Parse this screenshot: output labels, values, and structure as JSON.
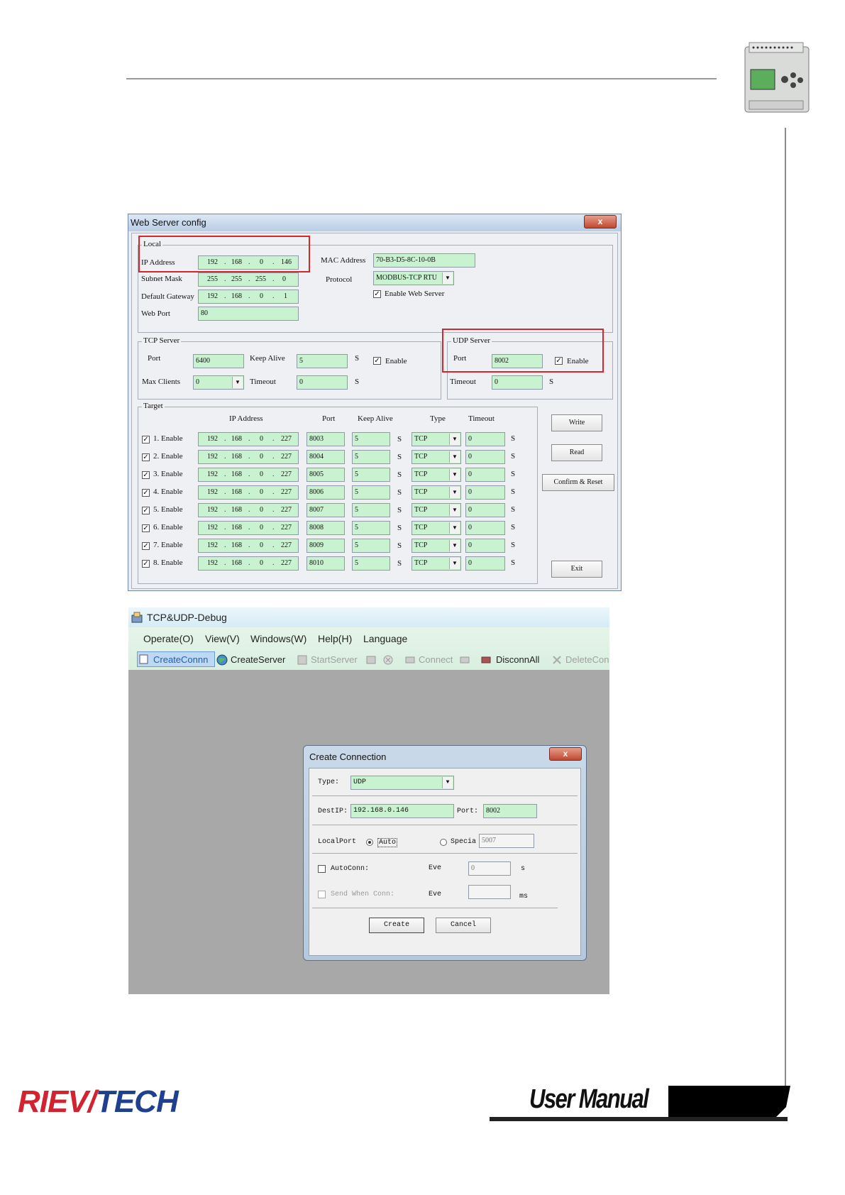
{
  "web_server_config": {
    "title": "Web Server config",
    "close": "x",
    "local": {
      "title": "Local",
      "ip_label": "IP Address",
      "ip": [
        "192",
        "168",
        "0",
        "146"
      ],
      "subnet_label": "Subnet Mask",
      "subnet": [
        "255",
        "255",
        "255",
        "0"
      ],
      "gateway_label": "Default Gateway",
      "gateway": [
        "192",
        "168",
        "0",
        "1"
      ],
      "webport_label": "Web Port",
      "webport": "80",
      "mac_label": "MAC Address",
      "mac": "70-B3-D5-8C-10-0B",
      "protocol_label": "Protocol",
      "protocol": "MODBUS-TCP RTU",
      "enable_web_label": "Enable Web Server"
    },
    "tcp_server": {
      "title": "TCP Server",
      "port_label": "Port",
      "port": "6400",
      "keepalive_label": "Keep Alive",
      "keepalive": "5",
      "unit": "S",
      "enable_label": "Enable",
      "maxclients_label": "Max Clients",
      "maxclients": "0",
      "timeout_label": "Timeout",
      "timeout": "0"
    },
    "udp_server": {
      "title": "UDP Server",
      "port_label": "Port",
      "port": "8002",
      "enable_label": "Enable",
      "timeout_label": "Timeout",
      "timeout": "0",
      "unit": "S"
    },
    "target": {
      "title": "Target",
      "headers": [
        "IP Address",
        "Port",
        "Keep Alive",
        "Type",
        "Timeout"
      ],
      "rows": [
        {
          "label": "1. Enable",
          "ip": [
            "192",
            "168",
            "0",
            "227"
          ],
          "port": "8003",
          "keepalive": "5",
          "type": "TCP",
          "timeout": "0"
        },
        {
          "label": "2. Enable",
          "ip": [
            "192",
            "168",
            "0",
            "227"
          ],
          "port": "8004",
          "keepalive": "5",
          "type": "TCP",
          "timeout": "0"
        },
        {
          "label": "3. Enable",
          "ip": [
            "192",
            "168",
            "0",
            "227"
          ],
          "port": "8005",
          "keepalive": "5",
          "type": "TCP",
          "timeout": "0"
        },
        {
          "label": "4. Enable",
          "ip": [
            "192",
            "168",
            "0",
            "227"
          ],
          "port": "8006",
          "keepalive": "5",
          "type": "TCP",
          "timeout": "0"
        },
        {
          "label": "5. Enable",
          "ip": [
            "192",
            "168",
            "0",
            "227"
          ],
          "port": "8007",
          "keepalive": "5",
          "type": "TCP",
          "timeout": "0"
        },
        {
          "label": "6. Enable",
          "ip": [
            "192",
            "168",
            "0",
            "227"
          ],
          "port": "8008",
          "keepalive": "5",
          "type": "TCP",
          "timeout": "0"
        },
        {
          "label": "7. Enable",
          "ip": [
            "192",
            "168",
            "0",
            "227"
          ],
          "port": "8009",
          "keepalive": "5",
          "type": "TCP",
          "timeout": "0"
        },
        {
          "label": "8. Enable",
          "ip": [
            "192",
            "168",
            "0",
            "227"
          ],
          "port": "8010",
          "keepalive": "5",
          "type": "TCP",
          "timeout": "0"
        }
      ],
      "unit": "S"
    },
    "buttons": {
      "write": "Write",
      "read": "Read",
      "confirm": "Confirm & Reset",
      "exit": "Exit"
    }
  },
  "debug": {
    "title": "TCP&UDP-Debug",
    "menu": [
      "Operate(O)",
      "View(V)",
      "Windows(W)",
      "Help(H)",
      "Language"
    ],
    "toolbar": {
      "create_conn": "CreateConnn",
      "create_server": "CreateServer",
      "start_server": "StartServer",
      "connect": "Connect",
      "disconn_all": "DisconnAll",
      "delete_conn": "DeleteCon"
    },
    "dialog": {
      "title": "Create Connection",
      "close": "x",
      "type_label": "Type:",
      "type": "UDP",
      "destip_label": "DestIP:",
      "destip": "192.168.0.146",
      "port_label": "Port:",
      "port": "8002",
      "localport_label": "LocalPort",
      "auto_label": "Auto",
      "special_label": "Specia",
      "special_value": "5007",
      "autoconn_label": "AutoConn:",
      "eve1_label": "Eve",
      "eve1_value": "0",
      "unit_s": "s",
      "sendwhen_label": "Send When Conn:",
      "eve2_label": "Eve",
      "unit_ms": "ms",
      "create": "Create",
      "cancel": "Cancel"
    }
  },
  "footer": {
    "logo_left": "RIEV",
    "logo_right": "TECH",
    "banner": "User Manual"
  },
  "colors": {
    "field": "#c9f2d0",
    "highlight": "#d8262e",
    "logo_red": "#d22330",
    "logo_blue": "#1f3f8f"
  }
}
